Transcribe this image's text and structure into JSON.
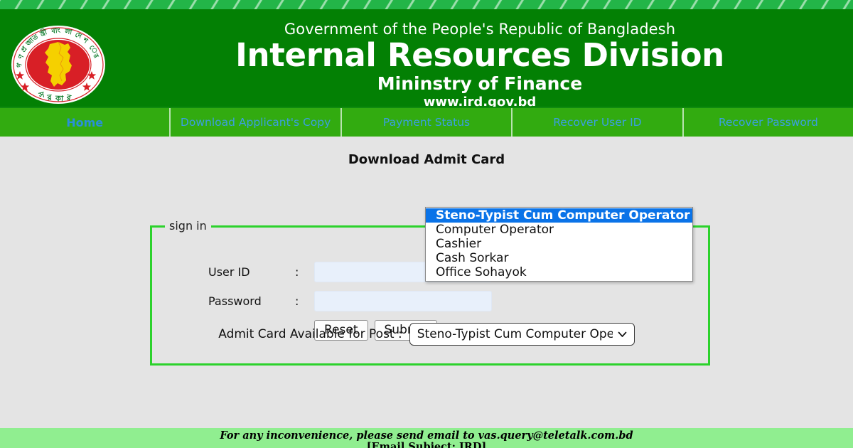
{
  "header": {
    "line1": "Government of the People's Republic of Bangladesh",
    "line2": "Internal Resources Division",
    "line3": "Mininstry of Finance",
    "line4": "www.ird.gov.bd",
    "logo_alt": "bangladesh-government-emblem"
  },
  "nav": {
    "items": [
      {
        "label": "Home",
        "active": true
      },
      {
        "label": "Download Applicant's Copy",
        "active": false
      },
      {
        "label": "Payment Status",
        "active": false
      },
      {
        "label": "Recover User ID",
        "active": false
      },
      {
        "label": "Recover Password",
        "active": false
      }
    ]
  },
  "main": {
    "title": "Download Admit Card",
    "post_label": "Admit Card Available for Post :",
    "select": {
      "value": "Steno-Typist Cum Computer Operator",
      "expanded": true,
      "options": [
        "Steno-Typist Cum Computer Operator",
        "Computer Operator",
        "Cashier",
        "Cash Sorkar",
        "Office Sohayok"
      ],
      "selected_index": 0
    },
    "signin": {
      "legend": "sign in",
      "user_id_label": "User ID",
      "password_label": "Password",
      "colon": ":",
      "user_id_value": "",
      "password_value": "",
      "reset_label": "Reset",
      "submit_label": "Submit"
    }
  },
  "footer": {
    "line1": "For any inconvenience, please send email to vas.query@teletalk.com.bd",
    "line2": "[Email Subject: IRD]"
  },
  "colors": {
    "header_green": "#038004",
    "nav_green": "#32ab10",
    "stripe_green": "#23b548",
    "fieldset_green": "#2cd22c",
    "footer_green": "#90ee90",
    "body_gray": "#e4e4e4",
    "nav_link_blue": "#3b9fe0",
    "dropdown_highlight": "#0a73e8",
    "input_blue": "#e8f0fb"
  }
}
